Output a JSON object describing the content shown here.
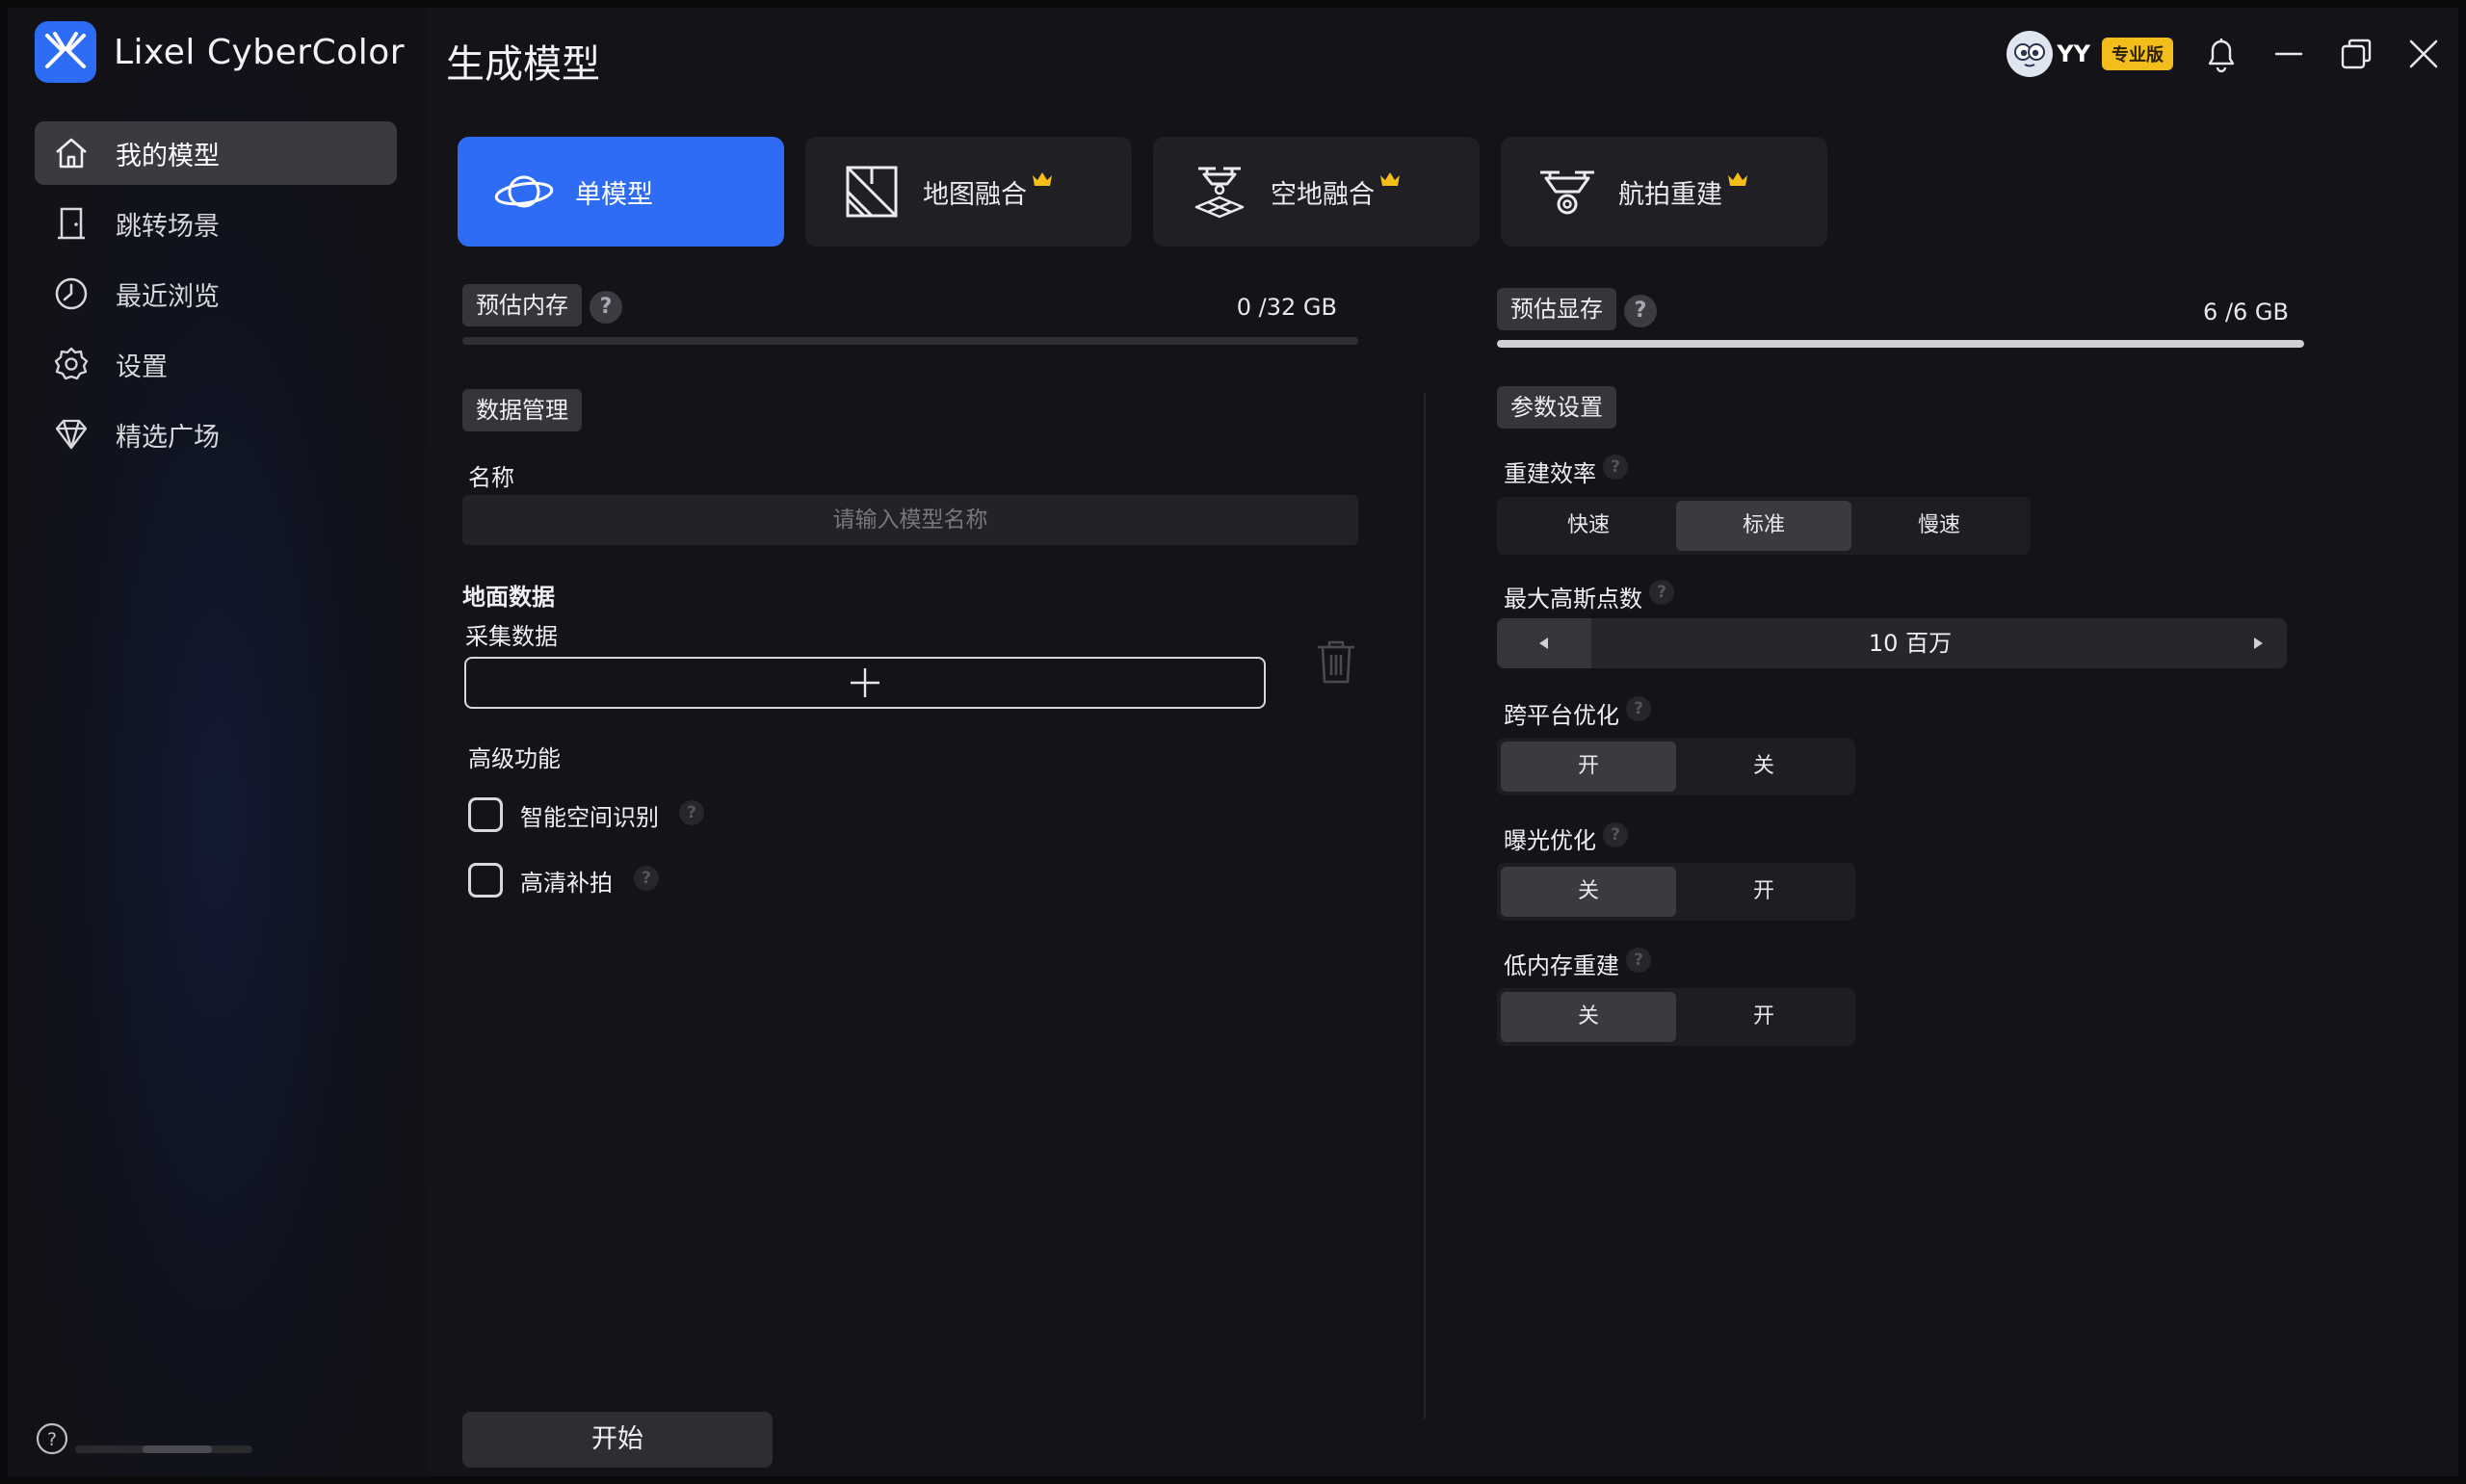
{
  "app": {
    "name": "Lixel CyberColor",
    "page_title": "生成模型"
  },
  "header": {
    "username": "YY",
    "badge": "专业版"
  },
  "sidebar": {
    "items": [
      {
        "label": "我的模型",
        "icon": "home-icon",
        "active": true
      },
      {
        "label": "跳转场景",
        "icon": "door-icon",
        "active": false
      },
      {
        "label": "最近浏览",
        "icon": "clock-icon",
        "active": false
      },
      {
        "label": "设置",
        "icon": "gear-icon",
        "active": false
      },
      {
        "label": "精选广场",
        "icon": "diamond-icon",
        "active": false
      }
    ]
  },
  "modes": [
    {
      "label": "单模型",
      "icon": "planet-icon",
      "active": true,
      "premium": false
    },
    {
      "label": "地图融合",
      "icon": "map-icon",
      "active": false,
      "premium": true
    },
    {
      "label": "空地融合",
      "icon": "drone-grid-icon",
      "active": false,
      "premium": true
    },
    {
      "label": "航拍重建",
      "icon": "drone-icon",
      "active": false,
      "premium": true
    }
  ],
  "left": {
    "memory": {
      "label": "预估内存",
      "value": "0 /32 GB",
      "fraction": 0
    },
    "data_section": "数据管理",
    "name_label": "名称",
    "name_placeholder": "请输入模型名称",
    "ground_data": "地面数据",
    "collect_data": "采集数据",
    "advanced": "高级功能",
    "checkboxes": [
      {
        "label": "智能空间识别",
        "checked": false
      },
      {
        "label": "高清补拍",
        "checked": false
      }
    ],
    "start": "开始"
  },
  "right": {
    "vram": {
      "label": "预估显存",
      "value": "6 /6 GB",
      "fraction": 1
    },
    "params_section": "参数设置",
    "efficiency": {
      "label": "重建效率",
      "options": [
        "快速",
        "标准",
        "慢速"
      ],
      "selected": 1
    },
    "max_gauss": {
      "label": "最大高斯点数",
      "value": "10 百万"
    },
    "cross_platform": {
      "label": "跨平台优化",
      "options": [
        "开",
        "关"
      ],
      "selected": 0
    },
    "exposure": {
      "label": "曝光优化",
      "options": [
        "关",
        "开"
      ],
      "selected": 0
    },
    "low_memory": {
      "label": "低内存重建",
      "options": [
        "关",
        "开"
      ],
      "selected": 0
    }
  },
  "qmark": "?",
  "colors": {
    "accent": "#2f6cf5",
    "badge": "#f3bd1b",
    "bg": "#141418",
    "panel": "#1f1f24"
  }
}
